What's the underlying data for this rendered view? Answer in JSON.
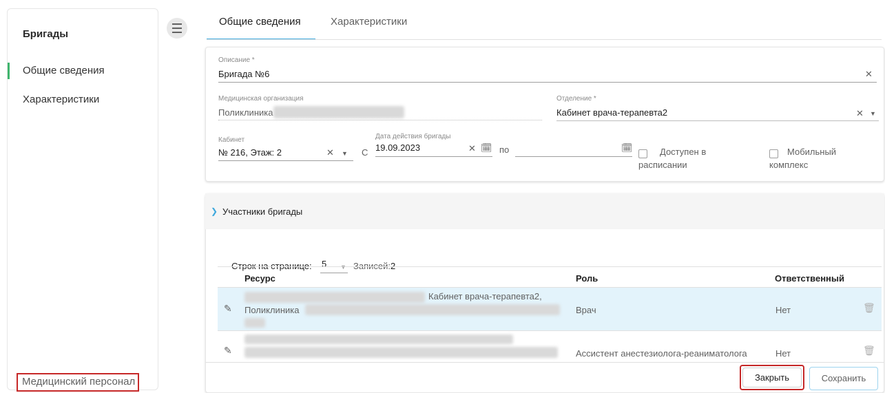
{
  "sidebar": {
    "title": "Бригады",
    "items": [
      {
        "label": "Общие сведения",
        "active": true
      },
      {
        "label": "Характеристики",
        "active": false
      }
    ],
    "bottom_link": "Медицинский персонал"
  },
  "tabs": [
    {
      "label": "Общие сведения",
      "active": true
    },
    {
      "label": "Характеристики",
      "active": false
    }
  ],
  "form": {
    "description": {
      "label": "Описание *",
      "value": "Бригада №6"
    },
    "organization": {
      "label": "Медицинская организация",
      "value": "Поликлиника"
    },
    "department": {
      "label": "Отделение *",
      "value": "Кабинет врача-терапевта2"
    },
    "cabinet": {
      "label": "Кабинет",
      "value": "№ 216, Этаж: 2"
    },
    "date": {
      "label": "Дата действия бригады",
      "from_prefix": "С",
      "from_value": "19.09.2023",
      "to_prefix": "по",
      "to_value": ""
    },
    "available_in_schedule": {
      "label": "Доступен в расписании",
      "line1": "Доступен в",
      "line2": "расписании",
      "checked": false
    },
    "mobile_complex": {
      "label": "Мобильный комплекс",
      "line1": "Мобильный",
      "line2": "комплекс",
      "checked": false
    }
  },
  "members": {
    "section_title": "Участники бригады",
    "rows_per_page_label": "Строк на странице:",
    "rows_per_page": "5",
    "records_label": "Записей:",
    "records_count": "2",
    "columns": [
      "Ресурс",
      "Роль",
      "Ответственный"
    ],
    "rows": [
      {
        "resource_line1": "Кабинет врача-терапевта2,",
        "resource_line2": "Поликлиника",
        "role": "Врач",
        "responsible": "Нет"
      },
      {
        "resource_line1": "",
        "resource_line2": "",
        "role": "Ассистент анестезиолога-реаниматолога",
        "responsible": "Нет"
      }
    ]
  },
  "buttons": {
    "close": "Закрыть",
    "save": "Сохранить"
  },
  "colors": {
    "accent": "#3fa9dd",
    "active_nav": "#3fb56d",
    "highlight": "#c62828",
    "selected_row": "#e3f3fb"
  }
}
